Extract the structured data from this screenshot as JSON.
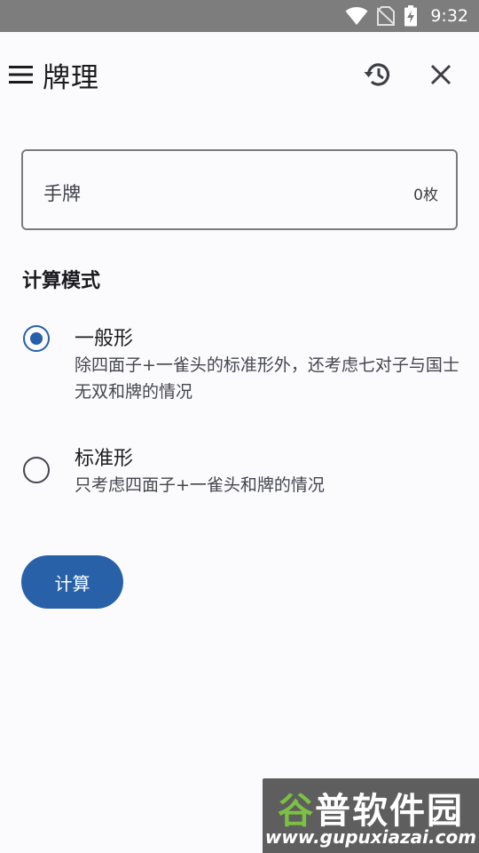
{
  "status_bar": {
    "time": "9:32",
    "icons": [
      "wifi-icon",
      "no-sim-icon",
      "battery-charging-icon"
    ]
  },
  "app_bar": {
    "title": "牌理",
    "icons": [
      "menu-icon",
      "history-icon",
      "close-icon"
    ]
  },
  "hand_input": {
    "label": "手牌",
    "count": "0枚"
  },
  "calc_mode": {
    "title": "计算模式",
    "options": [
      {
        "title": "一般形",
        "desc": "除四面子+一雀头的标准形外，还考虑七对子与国士无双和牌的情况",
        "checked": true
      },
      {
        "title": "标准形",
        "desc": "只考虑四面子+一雀头和牌的情况",
        "checked": false
      }
    ]
  },
  "actions": {
    "calc_label": "计算"
  },
  "watermark": {
    "title_part1": "谷",
    "title_part2": "普软件园",
    "url": "www.gupuxiazai.com"
  },
  "colors": {
    "accent": "#2961a8",
    "status_bar": "#7d7d7d",
    "background": "#fbfbfe"
  }
}
